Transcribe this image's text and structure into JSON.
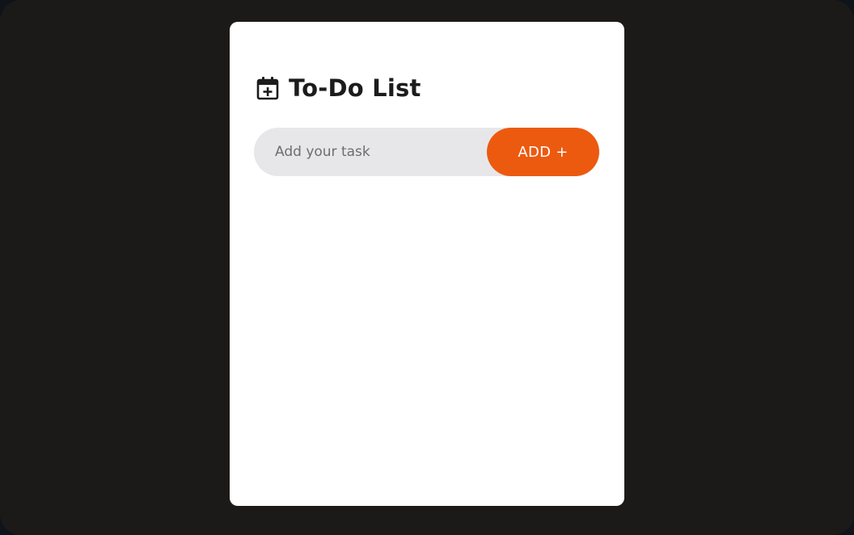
{
  "app": {
    "title": "To-Do List",
    "title_icon": "calendar-plus-icon"
  },
  "input": {
    "placeholder": "Add your task",
    "value": ""
  },
  "add_button": {
    "label": "ADD +"
  },
  "colors": {
    "background": "#1b1a19",
    "card": "#ffffff",
    "accent": "#ec5a10",
    "input_bg": "#e7e7ea"
  },
  "tasks": []
}
